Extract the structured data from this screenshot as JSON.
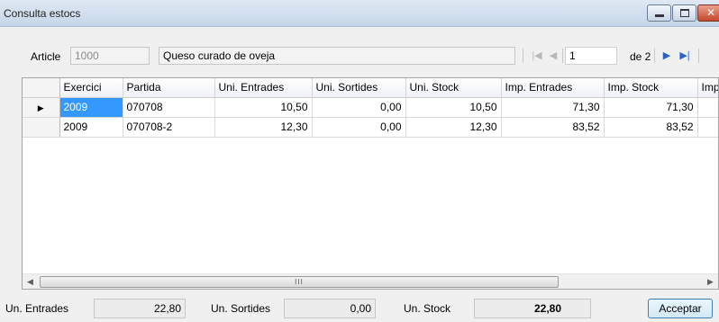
{
  "window": {
    "title": "Consulta estocs"
  },
  "article": {
    "label": "Article",
    "code": "1000",
    "description": "Queso curado de oveja"
  },
  "navigator": {
    "position": "1",
    "of_text": "de 2"
  },
  "grid": {
    "columns": [
      "",
      "Exercici",
      "Partida",
      "Uni. Entrades",
      "Uni. Sortides",
      "Uni. Stock",
      "Imp. Entrades",
      "Imp. Stock",
      "Imp"
    ],
    "rows": [
      {
        "cells": [
          "2009",
          "070708",
          "10,50",
          "0,00",
          "10,50",
          "71,30",
          "71,30",
          ""
        ]
      },
      {
        "cells": [
          "2009",
          "070708-2",
          "12,30",
          "0,00",
          "12,30",
          "83,52",
          "83,52",
          ""
        ]
      }
    ],
    "scroll_grip": "III"
  },
  "totals": {
    "entrades_label": "Un. Entrades",
    "entrades_value": "22,80",
    "sortides_label": "Un. Sortides",
    "sortides_value": "0,00",
    "stock_label": "Un. Stock",
    "stock_value": "22,80"
  },
  "accept_label": "Acceptar"
}
